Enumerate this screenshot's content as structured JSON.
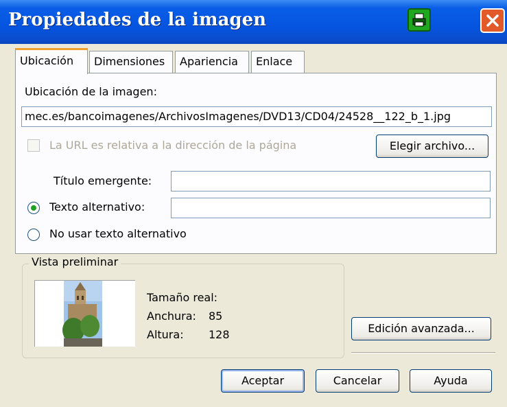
{
  "window": {
    "title": "Propiedades de la imagen"
  },
  "tabs": [
    {
      "label": "Ubicación",
      "active": true
    },
    {
      "label": "Dimensiones",
      "active": false
    },
    {
      "label": "Apariencia",
      "active": false
    },
    {
      "label": "Enlace",
      "active": false
    }
  ],
  "location": {
    "label": "Ubicación de la imagen:",
    "value": "mec.es/bancoimagenes/ArchivosImagenes/DVD13/CD04/24528__122_b_1.jpg",
    "relative_url_label": "La URL es relativa a la dirección de la página",
    "relative_url_checked": false,
    "choose_file_label": "Elegir archivo..."
  },
  "tooltip_title": {
    "label": "Título emergente:",
    "value": ""
  },
  "alt_text": {
    "label": "Texto alternativo:",
    "value": "",
    "selected": true
  },
  "no_alt_text": {
    "label": "No usar texto alternativo",
    "selected": false
  },
  "preview": {
    "legend": "Vista preliminar",
    "real_size_label": "Tamaño real:",
    "width_label": "Anchura:",
    "width_value": "85",
    "height_label": "Altura:",
    "height_value": "128",
    "advanced_edit_label": "Edición avanzada..."
  },
  "buttons": {
    "accept": "Aceptar",
    "cancel": "Cancelar",
    "help": "Ayuda"
  },
  "colors": {
    "titlebar": "#0554e0",
    "dialog_bg": "#ece9d8",
    "close": "#e25a2a",
    "printer": "#1fa81f"
  }
}
